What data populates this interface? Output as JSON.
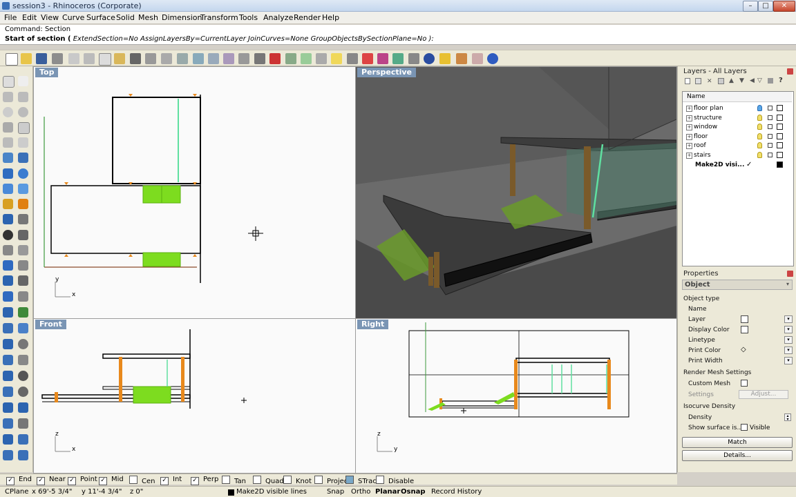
{
  "window": {
    "title": "session3 - Rhinoceros (Corporate)",
    "min": "–",
    "max": "□",
    "close": "✕"
  },
  "menu": [
    "File",
    "Edit",
    "View",
    "Curve",
    "Surface",
    "Solid",
    "Mesh",
    "Dimension",
    "Transform",
    "Tools",
    "Analyze",
    "Render",
    "Help"
  ],
  "command": {
    "history": "Command: Section",
    "prompt_bold": "Start of section (",
    "prompt_rest": "ExtendSection=No  AssignLayersBy=CurrentLayer  JoinCurves=None  GroupObjectsBySectionPlane=No ):"
  },
  "viewports": {
    "top": {
      "label": "Top",
      "axis1": "y",
      "axis2": "x"
    },
    "perspective": {
      "label": "Perspective"
    },
    "front": {
      "label": "Front",
      "axis1": "z",
      "axis2": "x"
    },
    "right": {
      "label": "Right",
      "axis1": "z",
      "axis2": "y"
    }
  },
  "layers_panel": {
    "title": "Layers - All Layers",
    "column_name": "Name",
    "layers": [
      {
        "name": "floor plan",
        "current": false
      },
      {
        "name": "structure",
        "current": false
      },
      {
        "name": "window",
        "current": false
      },
      {
        "name": "floor",
        "current": false
      },
      {
        "name": "roof",
        "current": false
      },
      {
        "name": "stairs",
        "current": false
      },
      {
        "name": "Make2D visi...",
        "current": true
      }
    ],
    "current_mark": "✓"
  },
  "properties_panel": {
    "title": "Properties",
    "tab": "Object",
    "section_object_type": "Object type",
    "fields": [
      "Name",
      "Layer",
      "Display Color",
      "Linetype",
      "Print Color",
      "Print Width"
    ],
    "render_mesh_settings": "Render Mesh Settings",
    "custom_mesh": "Custom Mesh",
    "settings": "Settings",
    "adjust": "Adjust...",
    "isocurve_density": "Isocurve Density",
    "density": "Density",
    "show_surface": "Show surface is...",
    "visible": "Visible",
    "match": "Match",
    "details": "Details..."
  },
  "osnaps": [
    {
      "label": "End",
      "checked": true
    },
    {
      "label": "Near",
      "checked": true
    },
    {
      "label": "Point",
      "checked": true
    },
    {
      "label": "Mid",
      "checked": true
    },
    {
      "label": "Cen",
      "checked": false
    },
    {
      "label": "Int",
      "checked": true
    },
    {
      "label": "Perp",
      "checked": true
    },
    {
      "label": "Tan",
      "checked": false
    },
    {
      "label": "Quad",
      "checked": false
    },
    {
      "label": "Knot",
      "checked": false
    },
    {
      "label": "Project",
      "checked": false
    },
    {
      "label": "STrack",
      "checked": false
    },
    {
      "label": "Disable",
      "checked": false
    }
  ],
  "status": {
    "cplane": "CPlane",
    "x": "x 69'-5 3/4\"",
    "y": "y 11'-4 3/4\"",
    "z": "z 0\"",
    "layer": "Make2D visible lines",
    "snap": "Snap",
    "ortho": "Ortho",
    "planar": "Planar",
    "osnap": "Osnap",
    "record_history": "Record History"
  },
  "colors": {
    "viewport_label": "#7a95b4",
    "green_geometry": "#7ddc1f",
    "orange_columns": "#e8891c",
    "green_lines": "#5fe0a0"
  }
}
